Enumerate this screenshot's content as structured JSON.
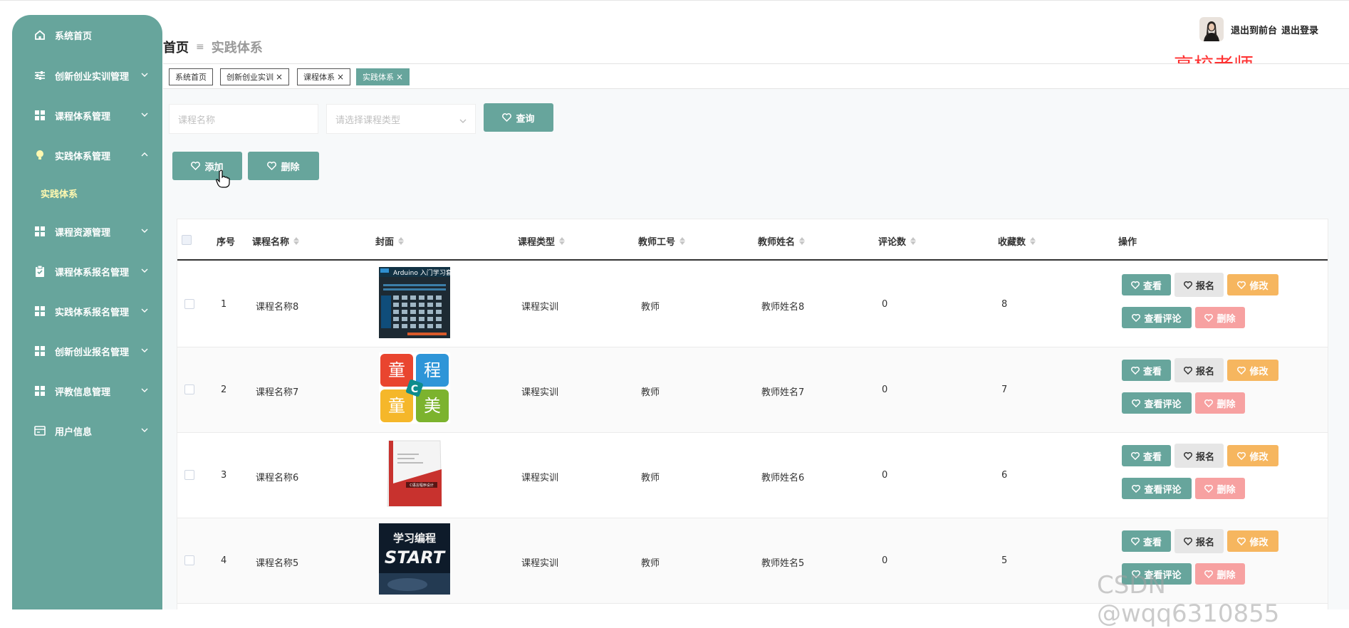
{
  "sidebar": {
    "items": [
      {
        "label": "系统首页"
      },
      {
        "label": "创新创业实训管理"
      },
      {
        "label": "课程体系管理"
      },
      {
        "label": "实践体系管理"
      },
      {
        "label": "课程资源管理"
      },
      {
        "label": "课程体系报名管理"
      },
      {
        "label": "实践体系报名管理"
      },
      {
        "label": "创新创业报名管理"
      },
      {
        "label": "评教信息管理"
      },
      {
        "label": "用户信息"
      }
    ],
    "sub_item": "实践体系"
  },
  "breadcrumb": {
    "home": "首页",
    "sep": "≡",
    "current": "实践体系"
  },
  "header": {
    "front_link": "退出到前台",
    "logout_link": "退出登录",
    "role": "高校老师"
  },
  "tabs": [
    {
      "label": "系统首页",
      "closable": false
    },
    {
      "label": "创新创业实训",
      "closable": true
    },
    {
      "label": "课程体系",
      "closable": true
    },
    {
      "label": "实践体系",
      "closable": true,
      "active": true
    }
  ],
  "search": {
    "name_placeholder": "课程名称",
    "type_placeholder": "请选择课程类型",
    "query_label": "查询"
  },
  "actions": {
    "add_label": "添加",
    "delete_label": "删除"
  },
  "table": {
    "columns": [
      "序号",
      "课程名称",
      "封面",
      "课程类型",
      "教师工号",
      "教师姓名",
      "评论数",
      "收藏数",
      "操作"
    ],
    "rows": [
      {
        "index": "1",
        "name": "课程名称8",
        "type": "课程实训",
        "teacher_no": "教师",
        "teacher_name": "教师姓名8",
        "comments": "0",
        "favorites": "8",
        "cover": "arduino"
      },
      {
        "index": "2",
        "name": "课程名称7",
        "type": "课程实训",
        "teacher_no": "教师",
        "teacher_name": "教师姓名7",
        "comments": "0",
        "favorites": "7",
        "cover": "kids-coding"
      },
      {
        "index": "3",
        "name": "课程名称6",
        "type": "课程实训",
        "teacher_no": "教师",
        "teacher_name": "教师姓名6",
        "comments": "0",
        "favorites": "6",
        "cover": "book"
      },
      {
        "index": "4",
        "name": "课程名称5",
        "type": "课程实训",
        "teacher_no": "教师",
        "teacher_name": "教师姓名5",
        "comments": "0",
        "favorites": "5",
        "cover": "start"
      }
    ],
    "ops": {
      "view": "查看",
      "enroll": "报名",
      "edit": "修改",
      "view_comments": "查看评论",
      "delete": "删除"
    }
  },
  "covers": {
    "arduino_title": "Arduino 入门学习套装",
    "kids": [
      "童",
      "程",
      "童",
      "美"
    ],
    "kids_center": "C",
    "book_title": "C语言程序设计",
    "start_top": "学习编程",
    "start_main": "START"
  },
  "watermark": "CSDN @wqq6310855",
  "colors": {
    "primary": "#67a59c",
    "edit": "#f6b65f",
    "delete": "#f7a1a1",
    "role": "#ff3030"
  }
}
